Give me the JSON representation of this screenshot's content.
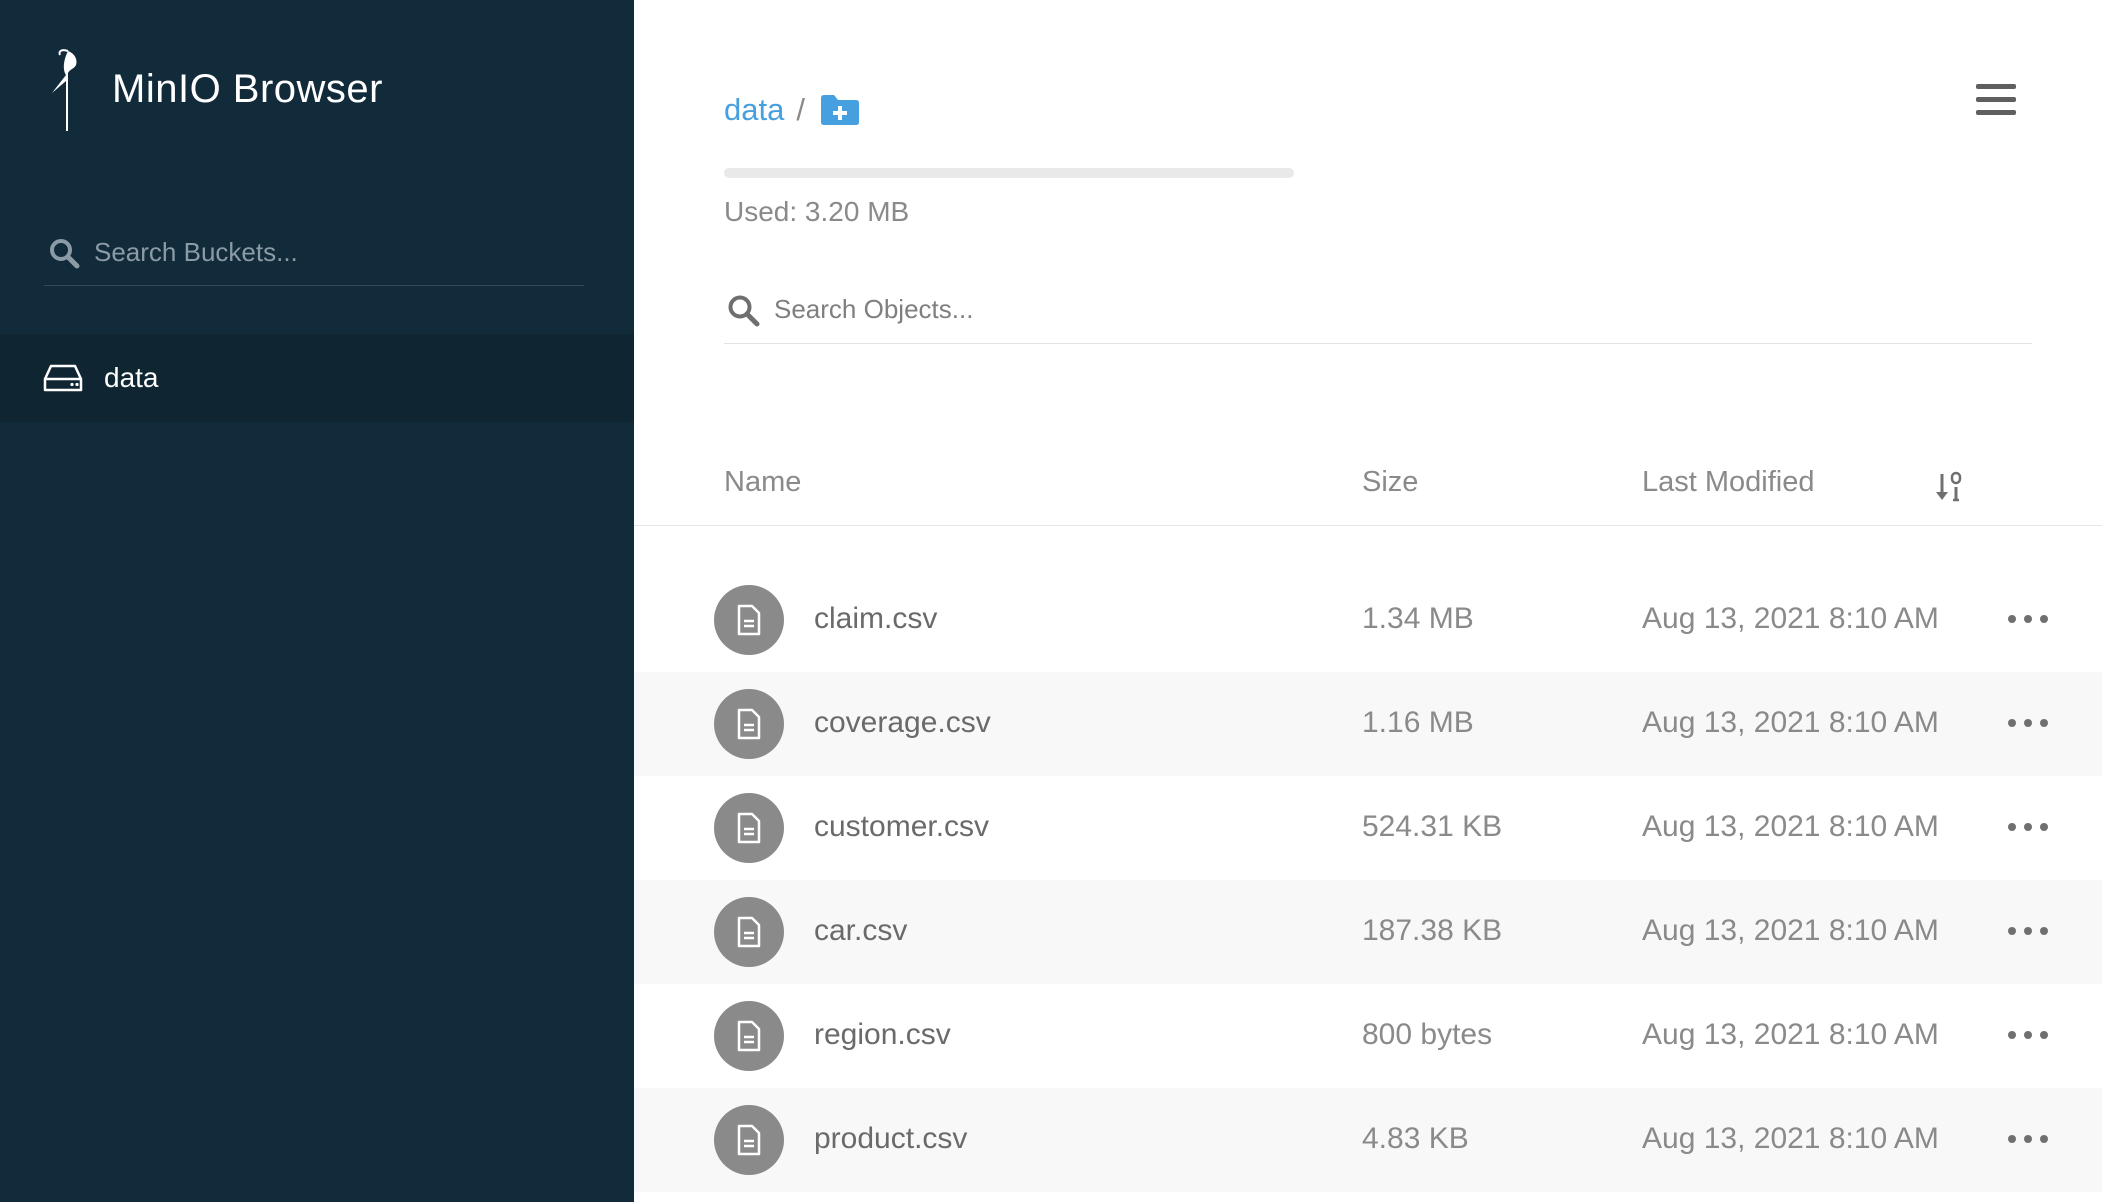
{
  "app": {
    "title": "MinIO Browser"
  },
  "sidebar": {
    "search": {
      "placeholder": "Search Buckets..."
    },
    "buckets": [
      {
        "label": "data",
        "active": true
      }
    ]
  },
  "breadcrumb": {
    "bucket": "data",
    "separator": "/"
  },
  "usage": {
    "text": "Used: 3.20 MB"
  },
  "object_search": {
    "placeholder": "Search Objects..."
  },
  "table": {
    "headers": {
      "name": "Name",
      "size": "Size",
      "modified": "Last Modified"
    },
    "rows": [
      {
        "name": "claim.csv",
        "size": "1.34 MB",
        "modified": "Aug 13, 2021 8:10 AM"
      },
      {
        "name": "coverage.csv",
        "size": "1.16 MB",
        "modified": "Aug 13, 2021 8:10 AM"
      },
      {
        "name": "customer.csv",
        "size": "524.31 KB",
        "modified": "Aug 13, 2021 8:10 AM"
      },
      {
        "name": "car.csv",
        "size": "187.38 KB",
        "modified": "Aug 13, 2021 8:10 AM"
      },
      {
        "name": "region.csv",
        "size": "800 bytes",
        "modified": "Aug 13, 2021 8:10 AM"
      },
      {
        "name": "product.csv",
        "size": "4.83 KB",
        "modified": "Aug 13, 2021 8:10 AM"
      }
    ]
  },
  "icons": {
    "logo": "minio-crane-icon",
    "bucket_search": "search-icon",
    "bucket": "hard-drive-icon",
    "folder_add": "folder-plus-icon",
    "menu": "hamburger-menu-icon",
    "object_search": "search-icon",
    "sort": "sort-icon",
    "file": "file-icon",
    "row_actions": "ellipsis-icon"
  },
  "colors": {
    "sidebar_bg": "#122b3a",
    "active_bucket_bg": "#0f2532",
    "accent": "#46a0e0",
    "file_icon_bg": "#8a8a8a"
  }
}
